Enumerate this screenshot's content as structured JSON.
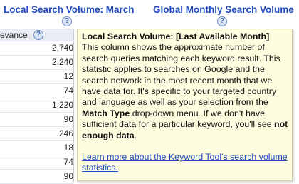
{
  "header": {
    "local_search_volume": "Local Search Volume: March",
    "global_search_volume": "Global Monthly Search Volume",
    "help_glyph": "?"
  },
  "column": {
    "label": "evance",
    "help_glyph": "?"
  },
  "values": [
    "2,740",
    "2,240",
    "12",
    "74",
    "1,220",
    "90",
    "246",
    "18",
    "74",
    "90"
  ],
  "tooltip": {
    "title": "Local Search Volume: [Last Available Month]",
    "body_1": "This column shows the approximate number of search queries matching each keyword result. This statistic applies to searches on Google and the search network in the most recent month that we have data for. It's specific to your targeted country and language as well as your selection from the ",
    "match_type": "Match Type",
    "body_2": " drop-down menu. If we don't have sufficient data for a particular keyword, you'll see ",
    "not_enough": "not enough data",
    "body_3": ".",
    "link": "Learn more about the Keyword Tool's search volume statistics."
  },
  "colors": {
    "link": "#1f4bbf",
    "tooltip_bg": "#fffde0"
  }
}
